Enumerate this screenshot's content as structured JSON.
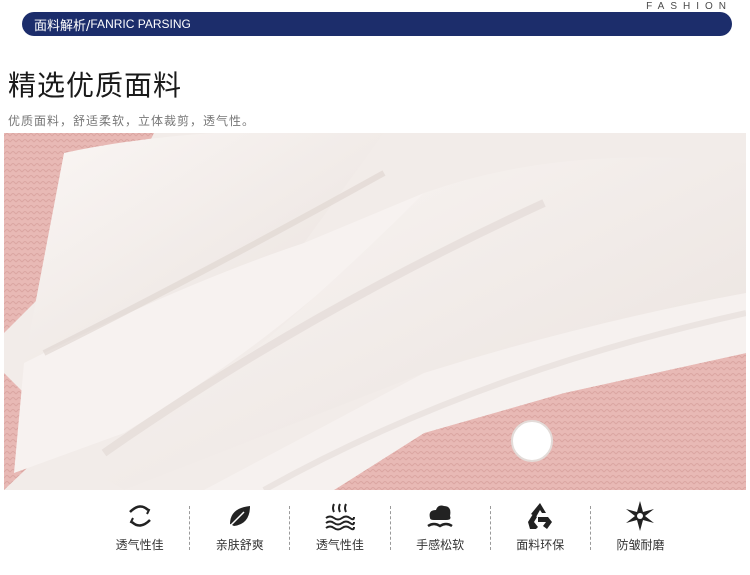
{
  "header": {
    "fashion_text": "FASHION",
    "banner_cn": "面料解析/",
    "banner_en": "FANRIC PARSING",
    "banner_color": "#1c2d6b"
  },
  "section": {
    "title": "精选优质面料",
    "subtitle": "优质面料，舒适柔软，立体裁剪，透气性。"
  },
  "features": [
    {
      "icon": "wind-swirl-icon",
      "label": "透气性佳"
    },
    {
      "icon": "leaf-icon",
      "label": "亲肤舒爽"
    },
    {
      "icon": "steam-waves-icon",
      "label": "透气性佳"
    },
    {
      "icon": "cloud-hand-icon",
      "label": "手感松软"
    },
    {
      "icon": "recycle-icon",
      "label": "面料环保"
    },
    {
      "icon": "star-burst-icon",
      "label": "防皱耐磨"
    }
  ],
  "colors": {
    "knit_pink": "#e9bcb8",
    "fabric_white": "#f5f0ee"
  }
}
